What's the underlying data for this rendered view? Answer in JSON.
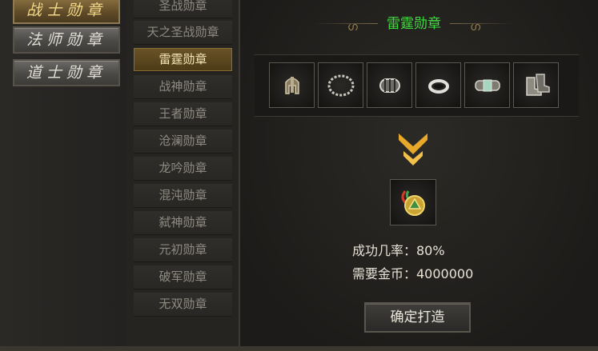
{
  "class_tabs": [
    {
      "label": "战士勋章",
      "active": true
    },
    {
      "label": "法师勋章",
      "active": false
    },
    {
      "label": "道士勋章",
      "active": false
    }
  ],
  "medal_list": [
    {
      "label": "圣战勋章",
      "active": false
    },
    {
      "label": "天之圣战勋章",
      "active": false
    },
    {
      "label": "雷霆勋章",
      "active": true
    },
    {
      "label": "战神勋章",
      "active": false
    },
    {
      "label": "王者勋章",
      "active": false
    },
    {
      "label": "沧澜勋章",
      "active": false
    },
    {
      "label": "龙吟勋章",
      "active": false
    },
    {
      "label": "混沌勋章",
      "active": false
    },
    {
      "label": "弑神勋章",
      "active": false
    },
    {
      "label": "元初勋章",
      "active": false
    },
    {
      "label": "破军勋章",
      "active": false
    },
    {
      "label": "无双勋章",
      "active": false
    }
  ],
  "panel": {
    "title": "雷霆勋章",
    "title_color": "#3fdc3f",
    "materials": [
      {
        "icon": "helmet-icon"
      },
      {
        "icon": "necklace-icon"
      },
      {
        "icon": "bracelet-icon"
      },
      {
        "icon": "ring-icon"
      },
      {
        "icon": "belt-icon"
      },
      {
        "icon": "boots-icon"
      }
    ],
    "result_icon": "medal-icon",
    "success_rate_label": "成功几率：80%",
    "gold_cost_label": "需要金币：4000000",
    "confirm_label": "确定打造"
  }
}
